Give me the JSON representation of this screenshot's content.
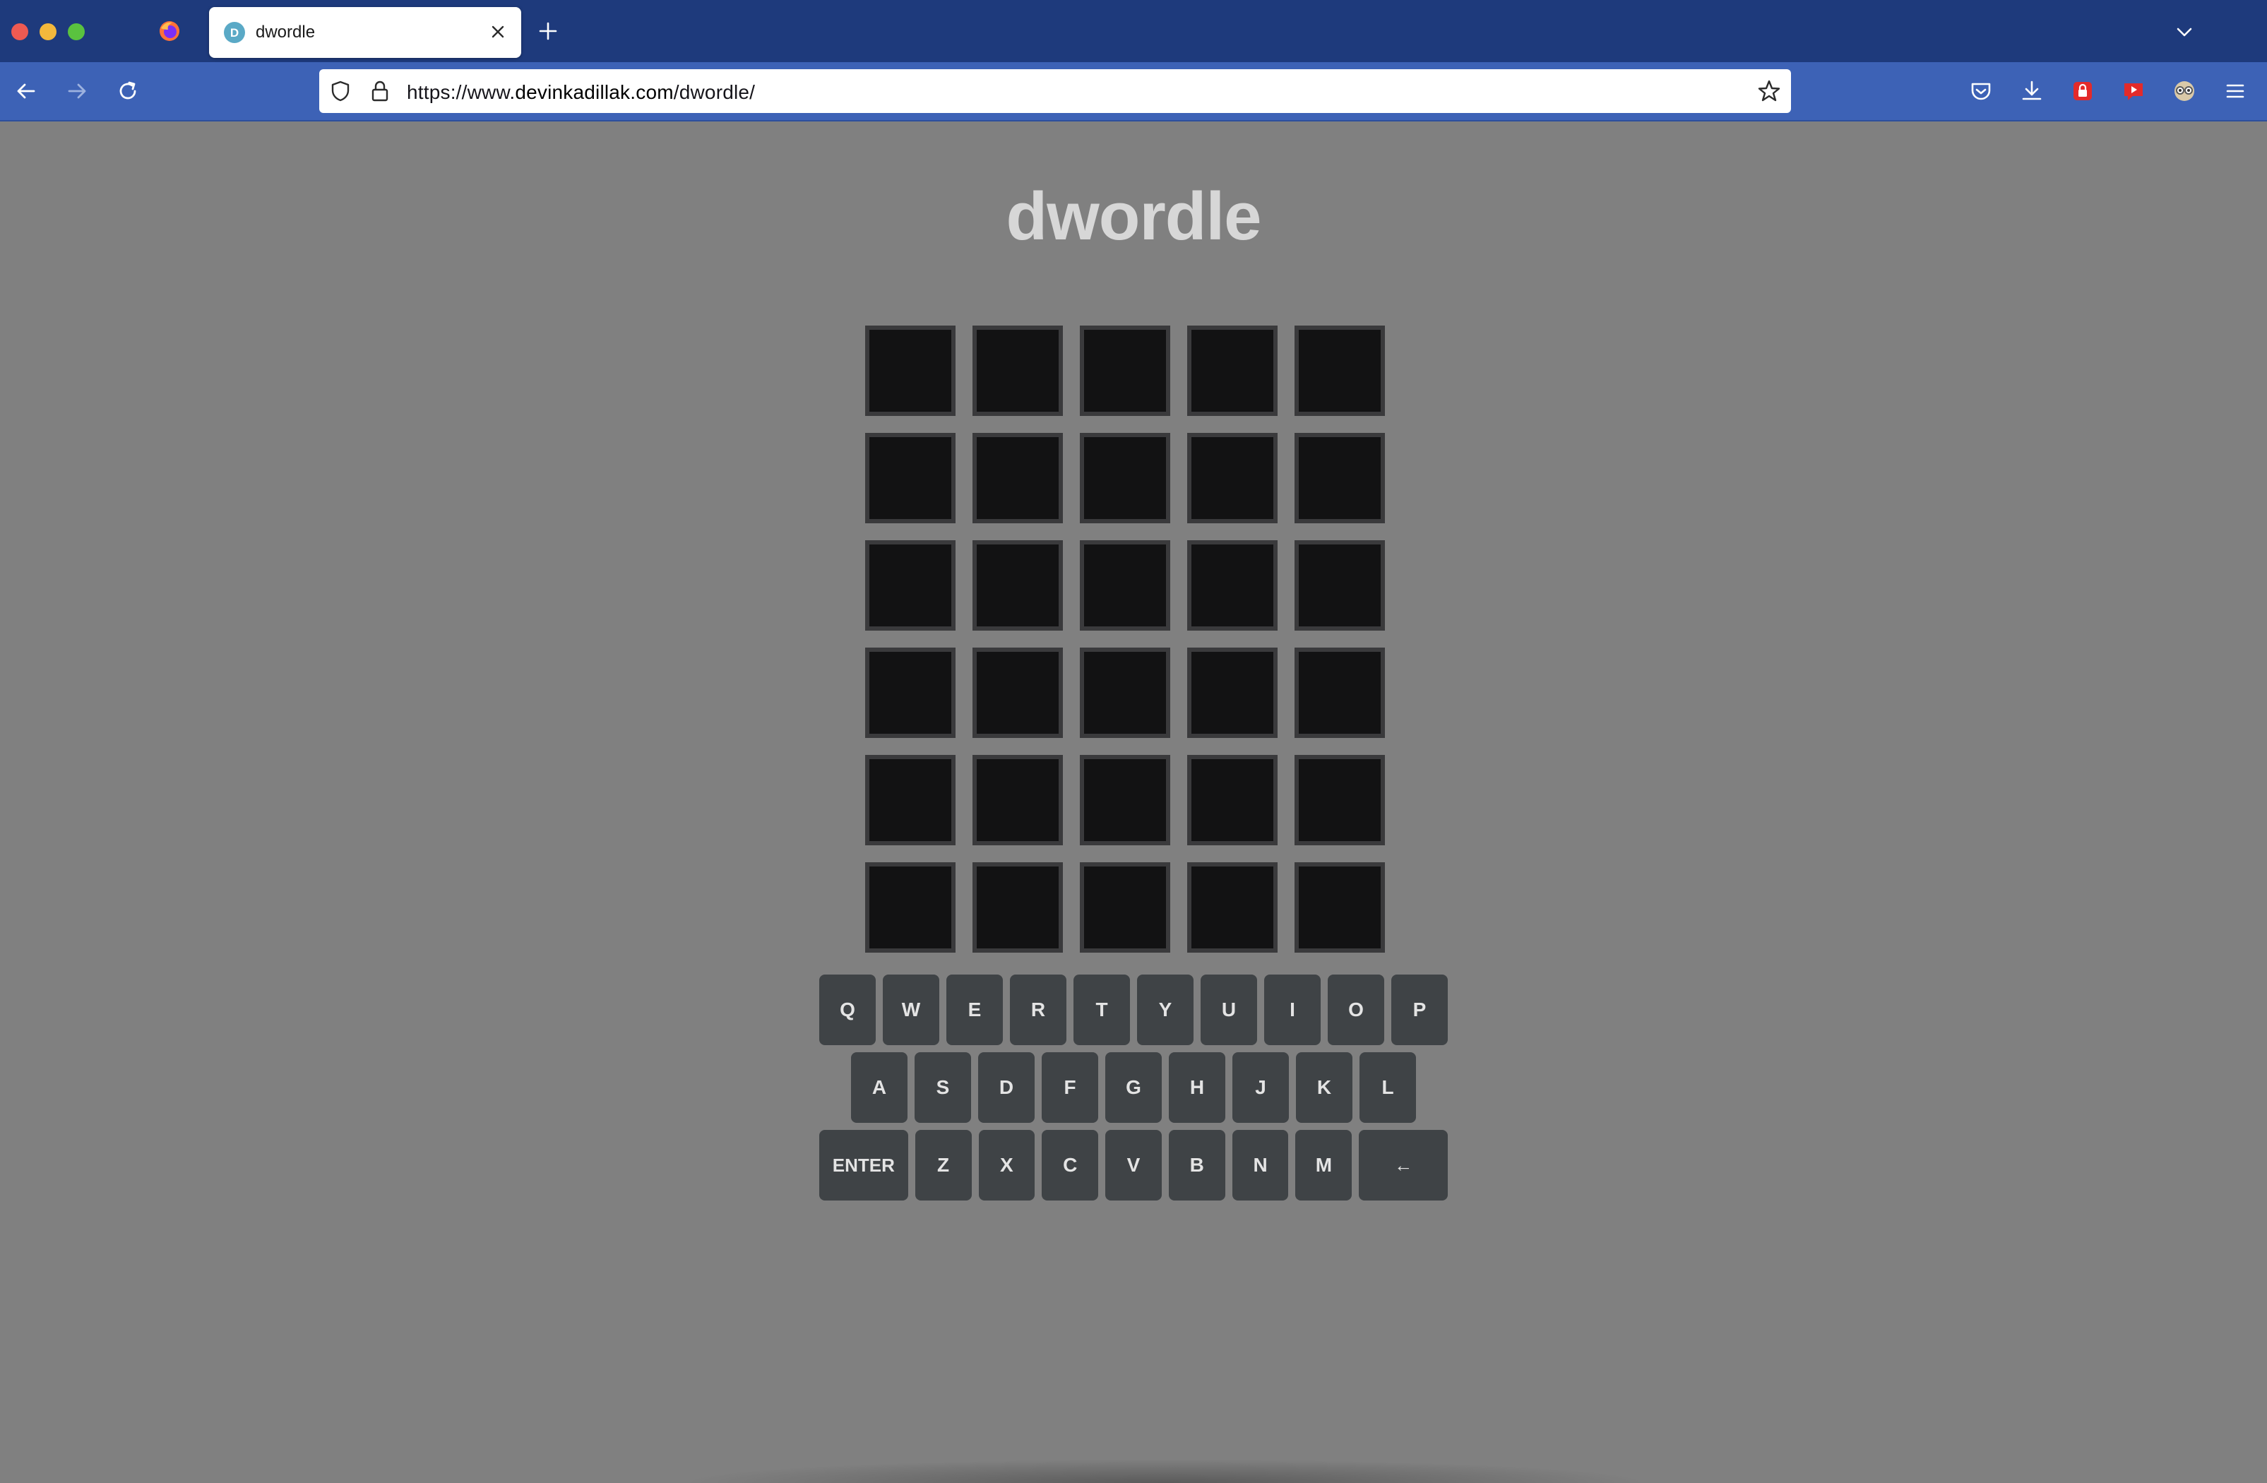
{
  "browser": {
    "tab_title": "dwordle",
    "tab_favicon_letter": "D",
    "url_prefix": "https://www.",
    "url_domain": "devinkadillak.com",
    "url_path": "/dwordle/",
    "icons": [
      "firefox-icon",
      "close-icon",
      "plus-icon",
      "chevron-down-icon",
      "back-arrow-icon",
      "forward-arrow-icon",
      "reload-icon",
      "shield-icon",
      "lock-icon",
      "star-icon",
      "pocket-icon",
      "download-icon",
      "addon-red-lock-icon",
      "addon-youtube-icon",
      "addon-avatar-icon",
      "menu-icon"
    ]
  },
  "game": {
    "title": "dwordle",
    "board": {
      "rows": [
        [
          "",
          "",
          "",
          "",
          ""
        ],
        [
          "",
          "",
          "",
          "",
          ""
        ],
        [
          "",
          "",
          "",
          "",
          ""
        ],
        [
          "",
          "",
          "",
          "",
          ""
        ],
        [
          "",
          "",
          "",
          "",
          ""
        ],
        [
          "",
          "",
          "",
          "",
          ""
        ]
      ]
    },
    "keyboard": {
      "row1": [
        "Q",
        "W",
        "E",
        "R",
        "T",
        "Y",
        "U",
        "I",
        "O",
        "P"
      ],
      "row2": [
        "A",
        "S",
        "D",
        "F",
        "G",
        "H",
        "J",
        "K",
        "L"
      ],
      "row3": [
        "ENTER",
        "Z",
        "X",
        "C",
        "V",
        "B",
        "N",
        "M",
        "←"
      ]
    }
  },
  "colors": {
    "page_bg": "#808080",
    "tile_bg": "#121213",
    "tile_border": "#3a3a3c",
    "key_bg": "#3f4346",
    "title_color": "#d7d7d7",
    "tab_strip": "#1e3a7c",
    "nav_bar": "#3d62b6"
  }
}
